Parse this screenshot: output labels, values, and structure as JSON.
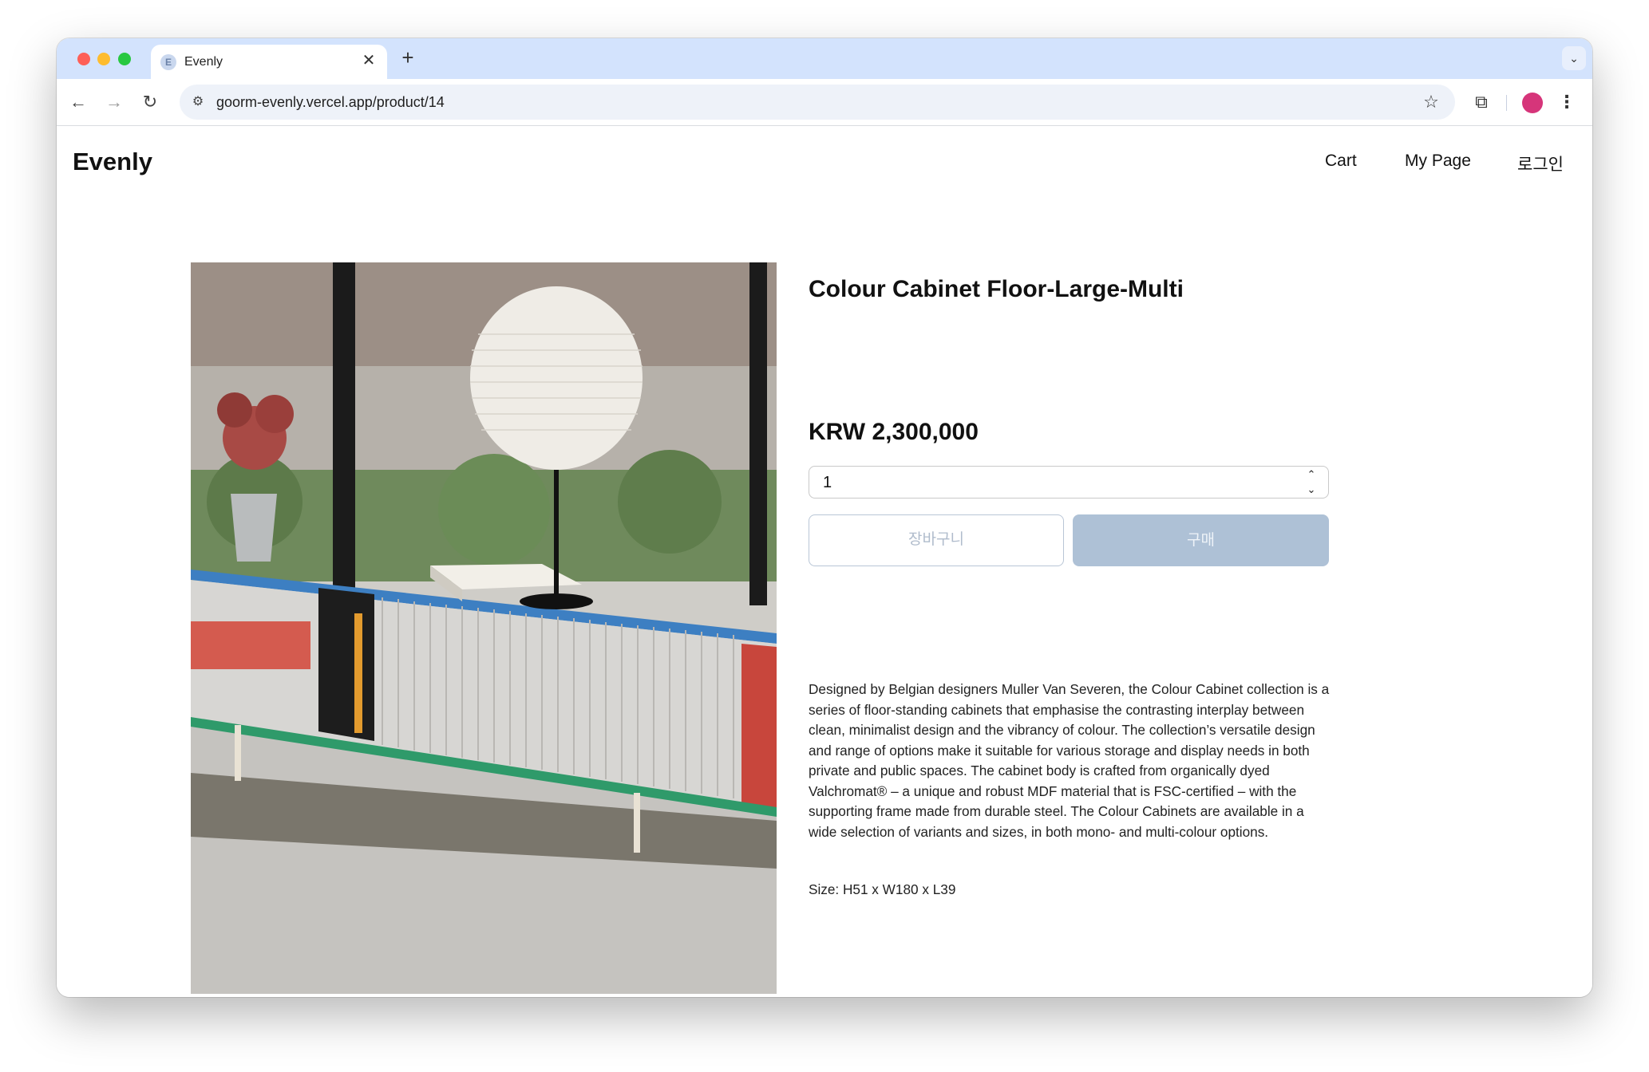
{
  "browser": {
    "tab_title": "Evenly",
    "tab_favicon_letter": "E",
    "tab_close": "✕",
    "new_tab": "+",
    "tab_menu": "⌄",
    "url": "goorm-evenly.vercel.app/product/14",
    "nav_back": "←",
    "nav_forward": "→",
    "nav_reload": "↻",
    "site_info": "⚙",
    "bookmark": "☆",
    "extensions": "⧉",
    "menu": "⋮",
    "profile_color": "#d6357a"
  },
  "site": {
    "logo": "Evenly",
    "nav": {
      "cart": "Cart",
      "my_page": "My Page",
      "login": "로그인"
    }
  },
  "product": {
    "title": "Colour Cabinet Floor-Large-Multi",
    "price": "KRW 2,300,000",
    "quantity": "1",
    "qty_up": "⌃",
    "qty_down": "⌄",
    "add_to_cart_label": "장바구니",
    "buy_label": "구매",
    "description": "Designed by Belgian designers Muller Van Severen, the Colour Cabinet collection is a series of floor-standing cabinets that emphasise the contrasting interplay between clean, minimalist design and the vibrancy of colour. The collection’s versatile design and range of options make it suitable for various storage and display needs in both private and public spaces. The cabinet body is crafted from organically dyed Valchromat® – a unique and robust MDF material that is FSC-certified – with the supporting frame made from durable steel. The Colour Cabinets are available in a wide selection of variants and sizes, in both mono- and multi-colour options.",
    "size": "Size: H51 x W180 x L39",
    "image_alt": "Colour cabinet with paper lamp and potted plant"
  },
  "colors": {
    "buy_button": "#aec1d6",
    "cart_button_border": "#b9c6d6",
    "tab_strip": "#d3e3fd"
  }
}
